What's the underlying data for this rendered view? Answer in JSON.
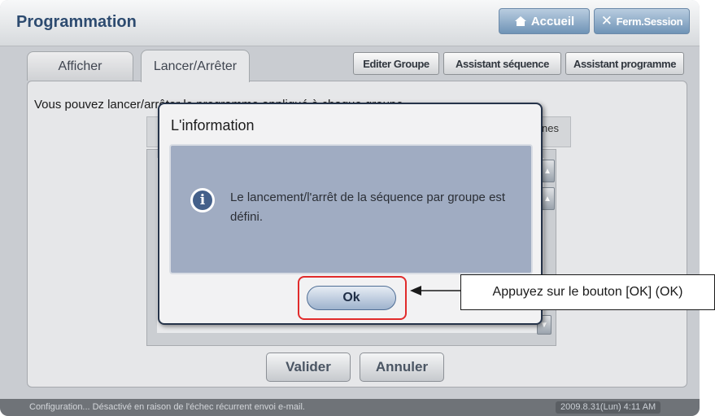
{
  "header": {
    "title": "Programmation",
    "home_label": "Accueil",
    "logout_label": "Ferm.Session"
  },
  "tabs": [
    {
      "label": "Afficher",
      "active": false
    },
    {
      "label": "Lancer/Arrêter",
      "active": true
    }
  ],
  "toolbar": {
    "edit_group": "Editer Groupe",
    "sequence_wizard": "Assistant séquence",
    "program_wizard": "Assistant programme"
  },
  "main": {
    "info_text": "Vous pouvez lancer/arrêter le programme appliqué à chaque groupe.",
    "column_header_partial": "nes"
  },
  "buttons": {
    "validate": "Valider",
    "cancel": "Annuler"
  },
  "dialog": {
    "title": "L'information",
    "message": "Le lancement/l'arrêt de la séquence par groupe est défini.",
    "ok_label": "Ok",
    "icon": "info-icon"
  },
  "callout": {
    "text": "Appuyez sur le bouton [OK] (OK)"
  },
  "status": {
    "message": "Configuration... Désactivé en raison de l'échec récurrent envoi e-mail.",
    "datetime": "2009.8.31(Lun) 4:11 AM"
  },
  "colors": {
    "title_text": "#2d4b70",
    "dialog_body": "#a0acc2",
    "highlight": "#e12b2b",
    "header_button": "#6f93b6"
  }
}
